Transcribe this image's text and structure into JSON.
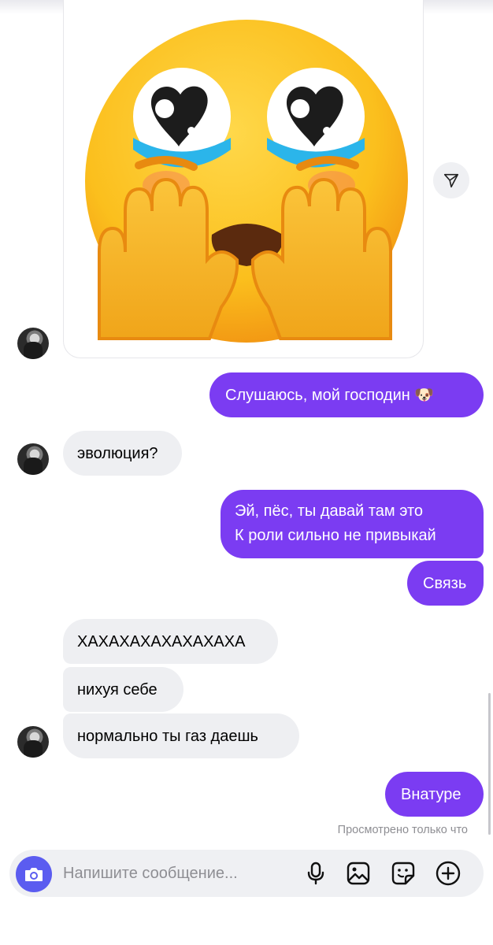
{
  "messages": {
    "m1": "Слушаюсь, мой господин 🐶",
    "m2": "эволюция?",
    "m3_line1": "Эй, пёс, ты давай там это",
    "m3_line2": "К роли сильно не привыкай",
    "m4": "Связь",
    "m5": "ХАХАХАХАХАХАХАХА",
    "m6": "нихуя себе",
    "m7": "нормально ты газ даешь",
    "m8": "Внатуре"
  },
  "status": {
    "seen": "Просмотрено только что"
  },
  "composer": {
    "placeholder": "Напишите сообщение..."
  },
  "icons": {
    "share": "share-icon",
    "camera": "camera-icon",
    "microphone": "microphone-icon",
    "gallery": "gallery-icon",
    "sticker": "sticker-icon",
    "plus": "plus-icon"
  },
  "colors": {
    "outgoing_bubble": "#7b3cf2",
    "incoming_bubble": "#eeeff2",
    "camera_button": "#5b5cf0"
  }
}
